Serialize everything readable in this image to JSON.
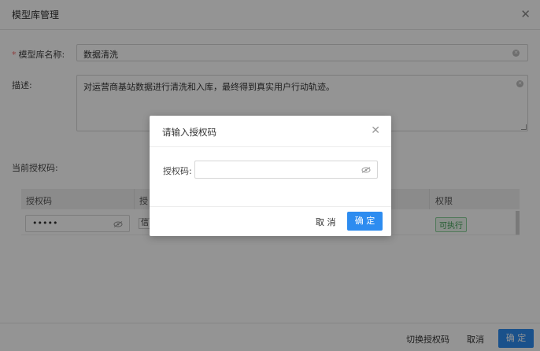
{
  "dialog": {
    "title": "模型库管理",
    "form": {
      "name_label": "模型库名称:",
      "name_value": "数据清洗",
      "desc_label": "描述:",
      "desc_value": "对运营商基站数据进行清洗和入库，最终得到真实用户行动轨迹。",
      "auth_label": "当前授权码:"
    },
    "table": {
      "col_auth": "授权码",
      "col_auth2": "授",
      "col_perm": "权限",
      "row_masked": "•••••",
      "row_partial": "信",
      "row_perm": "可执行"
    },
    "footer": {
      "switch_label": "切换授权码",
      "cancel_label": "取消",
      "confirm_label": "确 定"
    }
  },
  "modal": {
    "title": "请输入授权码",
    "field_label": "授权码:",
    "field_value": "",
    "cancel_label": "取 消",
    "confirm_label": "确 定"
  },
  "colors": {
    "primary": "#2d8cf0",
    "required": "#f56c6c",
    "tag_green": "#3c9e52"
  }
}
